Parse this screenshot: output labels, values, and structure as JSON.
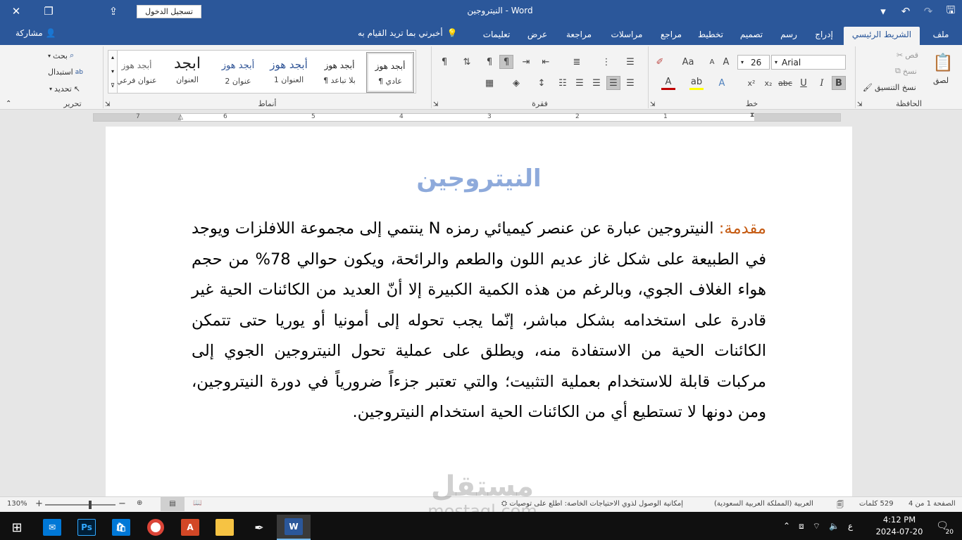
{
  "window": {
    "title": "النيتروجين  -  Word",
    "signin_label": "تسجيل الدخول"
  },
  "tabs": [
    {
      "label": "ملف"
    },
    {
      "label": "الشريط الرئيسي"
    },
    {
      "label": "إدراج"
    },
    {
      "label": "رسم"
    },
    {
      "label": "تصميم"
    },
    {
      "label": "تخطيط"
    },
    {
      "label": "مراجع"
    },
    {
      "label": "مراسلات"
    },
    {
      "label": "مراجعة"
    },
    {
      "label": "عرض"
    },
    {
      "label": "تعليمات"
    }
  ],
  "tell_me": "أخبرني بما تريد القيام به",
  "share": "مشاركة",
  "clipboard": {
    "group": "الحافظة",
    "paste": "لصق",
    "cut": "قص",
    "copy": "نسخ",
    "format_painter": "نسخ التنسيق"
  },
  "font": {
    "group": "خط",
    "name": "Arial",
    "size": "26"
  },
  "paragraph": {
    "group": "فقرة"
  },
  "styles": {
    "group": "أنماط",
    "items": [
      {
        "sample": "أبجد هوز",
        "name": "¶ عادي"
      },
      {
        "sample": "أبجد هوز",
        "name": "¶ بلا تباعد"
      },
      {
        "sample": "أبجد هوز",
        "name": "العنوان 1"
      },
      {
        "sample": "أبجد هوز",
        "name": "عنوان 2"
      },
      {
        "sample": "ابجد",
        "name": "العنوان"
      },
      {
        "sample": "أبجد هوز",
        "name": "عنوان فرعي"
      }
    ]
  },
  "editing": {
    "group": "تحرير",
    "find": "بحث",
    "replace": "استبدال",
    "select": "تحديد"
  },
  "ruler": {
    "numbers": [
      "7",
      "6",
      "5",
      "4",
      "3",
      "2",
      "1"
    ]
  },
  "document": {
    "title": "النيتروجين",
    "intro_label": "مقدمة:",
    "body": " النيتروجين عبارة عن عنصر كيميائي رمزه N ينتمي إلى مجموعة اللافلزات ويوجد في الطبيعة على شكل غاز عديم اللون والطعم والرائحة، ويكون حوالي 78% من حجم هواء الغلاف الجوي، وبالرغم من هذه الكمية الكبيرة إلا أنّ العديد من الكائنات الحية غير قادرة على استخدامه بشكل مباشر، إنّما يجب تحوله إلى أمونيا أو يوريا حتى تتمكن الكائنات الحية من الاستفادة منه، ويطلق على عملية تحول النيتروجين الجوي إلى مركبات قابلة للاستخدام بعملية التثبيت؛ والتي تعتبر جزءاً ضرورياً في دورة النيتروجين، ومن دونها لا تستطيع أي من الكائنات الحية استخدام النيتروجين."
  },
  "status": {
    "page": "الصفحة 1 من 4",
    "words": "529 كلمات",
    "language": "العربية (المملكة العربية السعودية)",
    "accessibility": "إمكانية الوصول لذوي الاحتياجات الخاصة: اطلع على توصيات",
    "zoom": "130%",
    "zoom_level": 0.65
  },
  "taskbar": {
    "time": "4:12 PM",
    "date": "2024-07-20",
    "notification_count": "20",
    "input_lang": "ع"
  },
  "watermark": {
    "arabic": "مستقل",
    "latin": "mostaql.com"
  },
  "colors": {
    "accent": "#2b579a",
    "title_text": "#8eaadb",
    "intro_text": "#c55a11"
  }
}
